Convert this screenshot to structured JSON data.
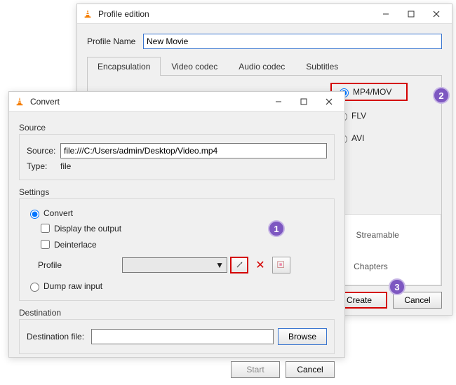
{
  "profile_window": {
    "title": "Profile edition",
    "profile_name_label": "Profile Name",
    "profile_name_value": "New Movie",
    "tabs": {
      "encapsulation": "Encapsulation",
      "video": "Video codec",
      "audio": "Audio codec",
      "subtitles": "Subtitles"
    },
    "formats": {
      "mp4mov": "MP4/MOV",
      "flv": "FLV",
      "avi": "AVI"
    },
    "features": {
      "streamable": "Streamable",
      "chapters": "Chapters"
    },
    "buttons": {
      "create": "Create",
      "cancel": "Cancel"
    }
  },
  "convert_window": {
    "title": "Convert",
    "sections": {
      "source": "Source",
      "settings": "Settings",
      "destination": "Destination"
    },
    "source_label": "Source:",
    "source_value": "file:///C:/Users/admin/Desktop/Video.mp4",
    "type_label": "Type:",
    "type_value": "file",
    "convert_radio": "Convert",
    "display_output": "Display the output",
    "deinterlace": "Deinterlace",
    "profile_label": "Profile",
    "dump_raw": "Dump raw input",
    "dest_label": "Destination file:",
    "buttons": {
      "browse": "Browse",
      "start": "Start",
      "cancel": "Cancel"
    }
  },
  "annotations": {
    "one": "1",
    "two": "2",
    "three": "3"
  }
}
